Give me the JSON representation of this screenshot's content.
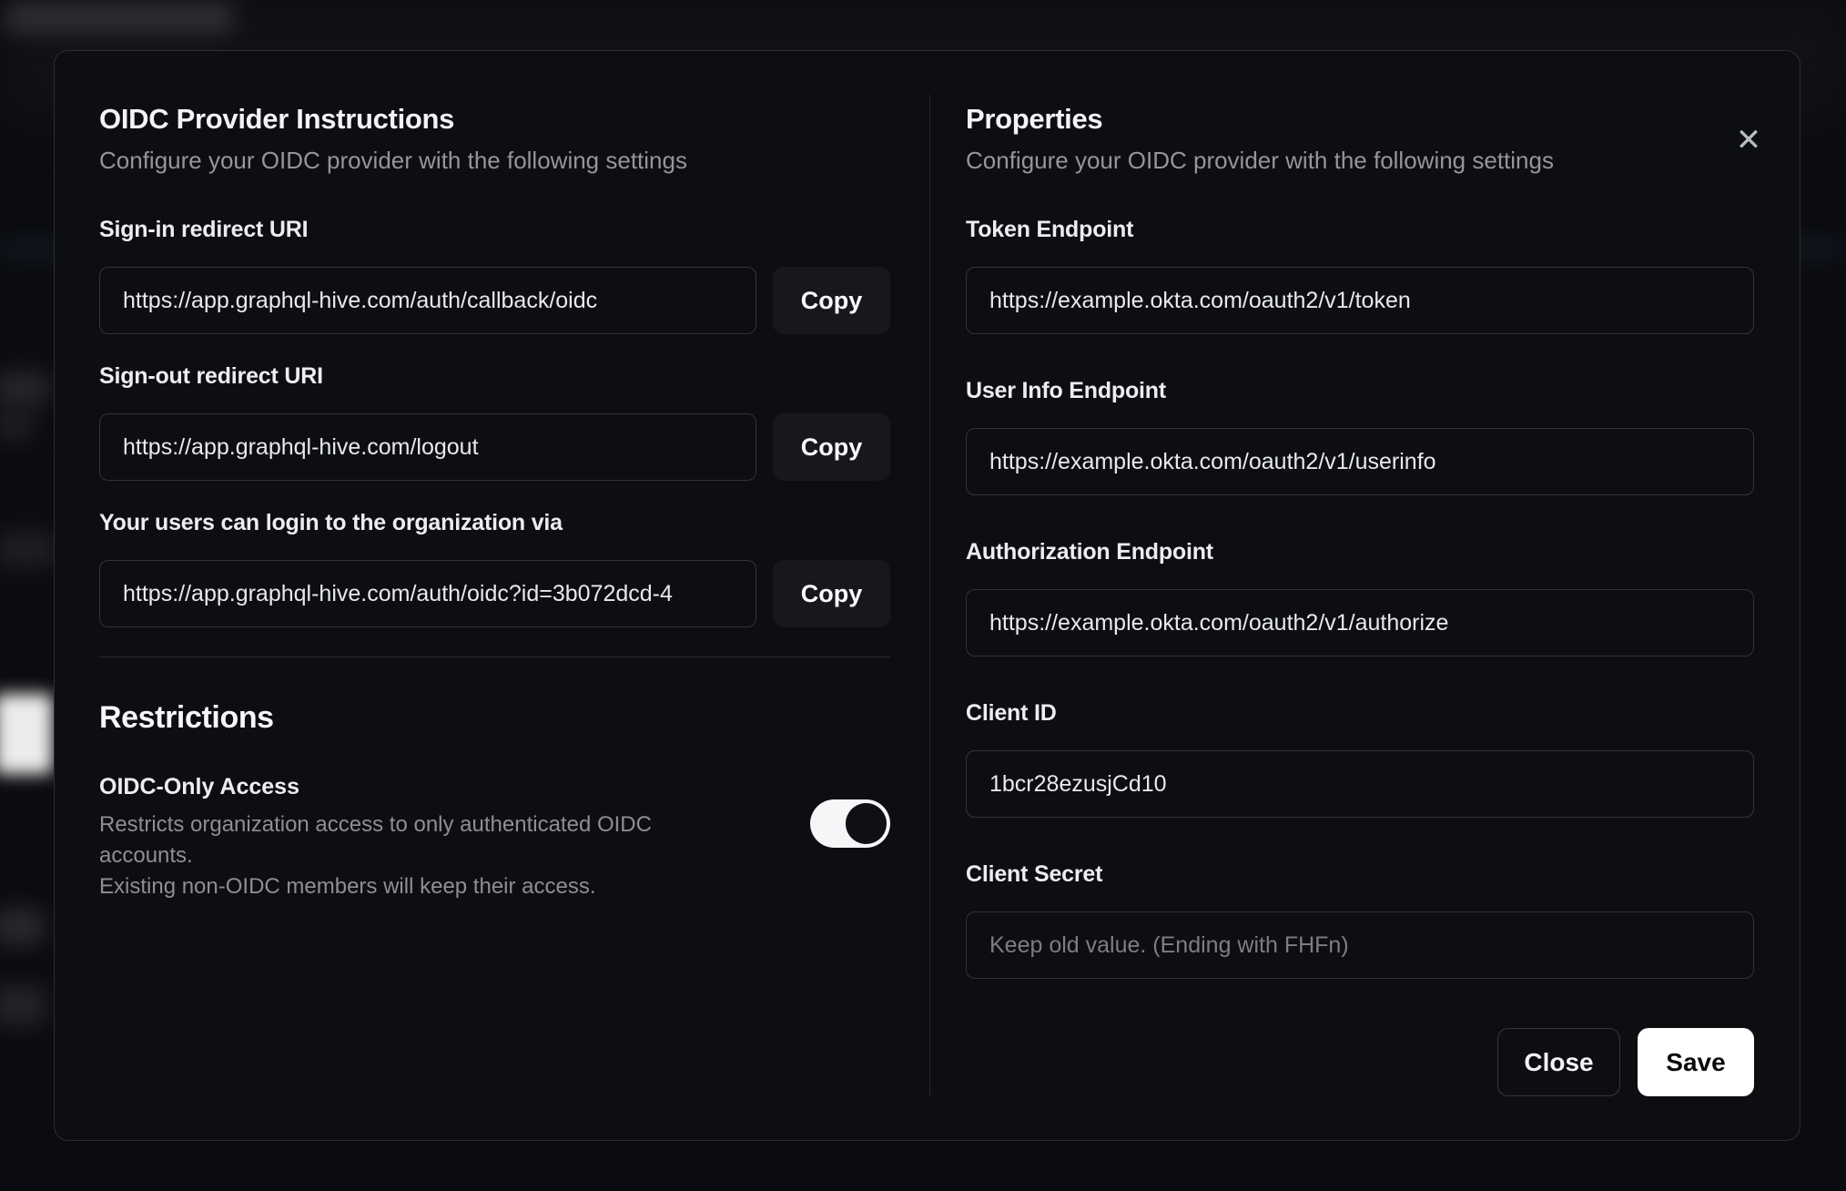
{
  "modal": {
    "close_icon": "✕",
    "left": {
      "title": "OIDC Provider Instructions",
      "subtitle": "Configure your OIDC provider with the following settings",
      "fields": [
        {
          "label": "Sign-in redirect URI",
          "value": "https://app.graphql-hive.com/auth/callback/oidc",
          "copy_label": "Copy"
        },
        {
          "label": "Sign-out redirect URI",
          "value": "https://app.graphql-hive.com/logout",
          "copy_label": "Copy"
        },
        {
          "label": "Your users can login to the organization via",
          "value": "https://app.graphql-hive.com/auth/oidc?id=3b072dcd-4",
          "copy_label": "Copy"
        }
      ],
      "restrictions": {
        "title": "Restrictions",
        "toggle_label": "OIDC-Only Access",
        "description_line1": "Restricts organization access to only authenticated OIDC accounts.",
        "description_line2": "Existing non-OIDC members will keep their access.",
        "toggle_state": "on"
      }
    },
    "right": {
      "title": "Properties",
      "subtitle": "Configure your OIDC provider with the following settings",
      "fields": [
        {
          "label": "Token Endpoint",
          "value": "https://example.okta.com/oauth2/v1/token"
        },
        {
          "label": "User Info Endpoint",
          "value": "https://example.okta.com/oauth2/v1/userinfo"
        },
        {
          "label": "Authorization Endpoint",
          "value": "https://example.okta.com/oauth2/v1/authorize"
        },
        {
          "label": "Client ID",
          "value": "1bcr28ezusjCd10"
        },
        {
          "label": "Client Secret",
          "value": "",
          "placeholder": "Keep old value. (Ending with FHFn)"
        }
      ],
      "buttons": {
        "close": "Close",
        "save": "Save"
      }
    },
    "colors": {
      "modal_background": "#0d0e12",
      "backdrop": "#0b0c0f",
      "accent_button": "#ffffff",
      "copy_button": "#17181d",
      "muted_text": "#95959a",
      "toggle_track": "#f5f6f7",
      "toggle_thumb": "#0e1014"
    }
  }
}
